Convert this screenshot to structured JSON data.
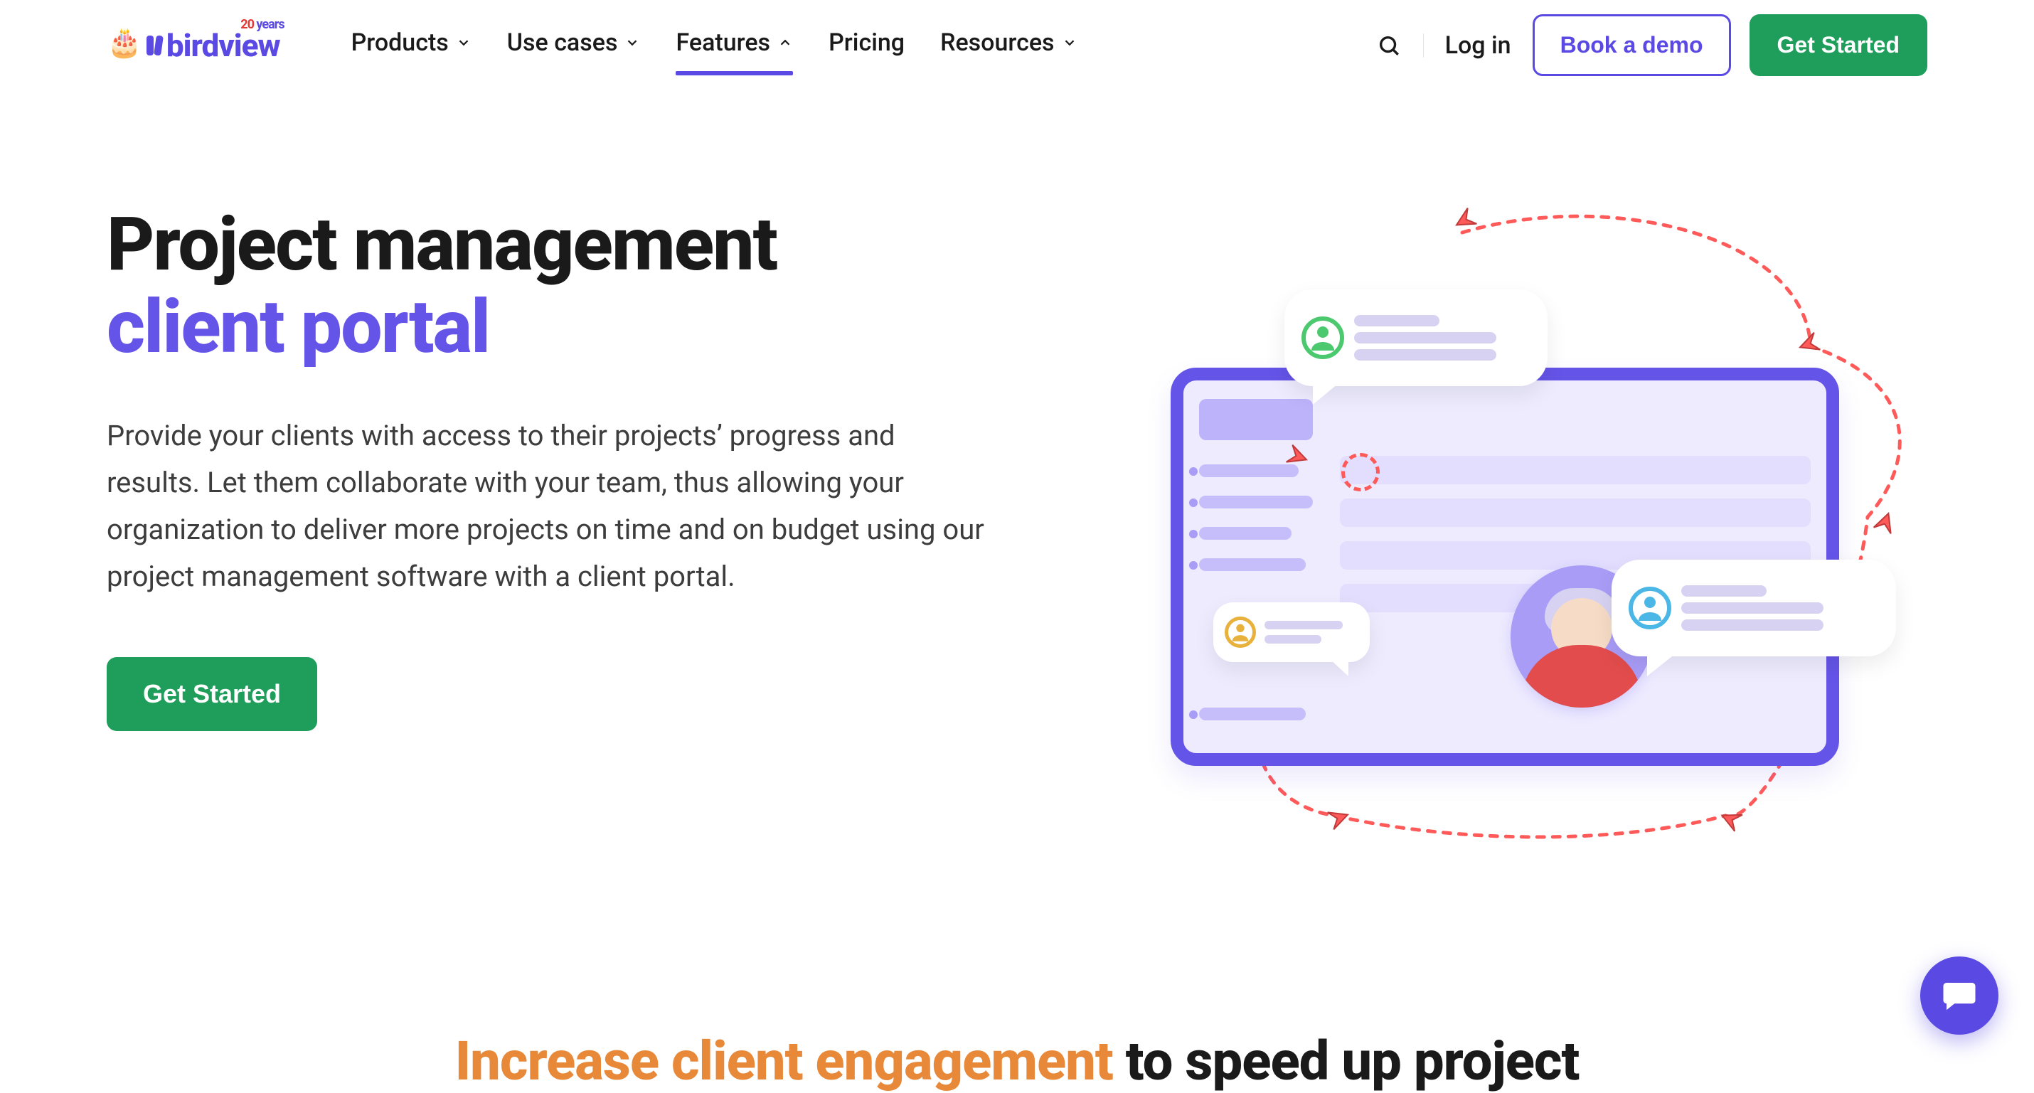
{
  "brand": {
    "name": "birdview",
    "badge_number": "20",
    "badge_text": "years"
  },
  "nav": {
    "items": [
      {
        "label": "Products",
        "active": false,
        "chev": "down"
      },
      {
        "label": "Use cases",
        "active": false,
        "chev": "down"
      },
      {
        "label": "Features",
        "active": true,
        "chev": "up"
      },
      {
        "label": "Pricing",
        "active": false,
        "chev": null
      },
      {
        "label": "Resources",
        "active": false,
        "chev": "down"
      }
    ]
  },
  "actions": {
    "login": "Log in",
    "book_demo": "Book a demo",
    "get_started": "Get Started"
  },
  "hero": {
    "title_line1": "Project management",
    "title_line2": "client portal",
    "subtitle": "Provide your clients with access to their projects’ progress and results. Let them collaborate with your team, thus allowing your organization to deliver more projects on time and on budget using our project management software with a client portal.",
    "cta": "Get Started"
  },
  "section2": {
    "highlight": "Increase client engagement",
    "rest": " to speed up project"
  }
}
